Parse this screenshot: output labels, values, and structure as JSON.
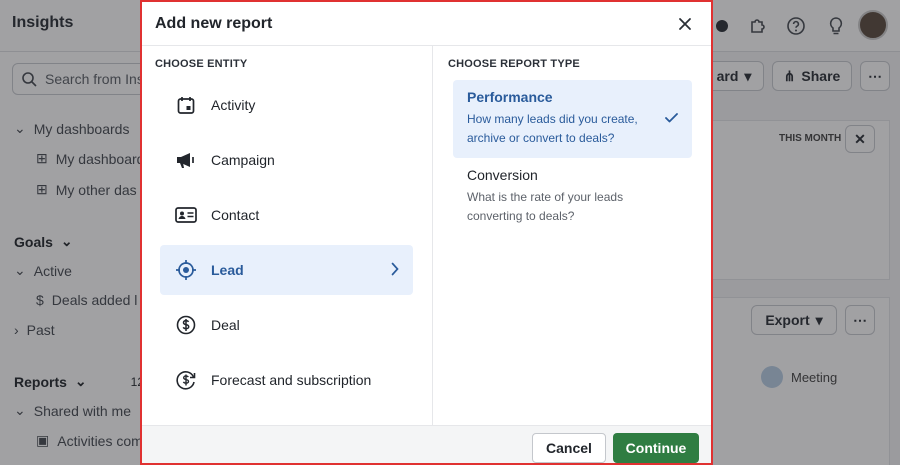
{
  "background": {
    "app_title": "Insights",
    "search_placeholder": "Search from Ins",
    "sidebar": {
      "my_dashboards": "My dashboards",
      "my_dashboard": "My dashboard",
      "my_other_dashboard": "My other das",
      "goals": "Goals",
      "active": "Active",
      "deals_added": "Deals added l",
      "past": "Past",
      "reports": "Reports",
      "reports_count": "12/",
      "shared_with_me": "Shared with me",
      "activities": "Activities com"
    },
    "right_panel": {
      "dashboard_btn": "ard",
      "share_btn": "Share",
      "this_month": "THIS MONTH",
      "export_btn": "Export",
      "meeting": "Meeting"
    }
  },
  "modal": {
    "title": "Add new report",
    "entity_heading": "CHOOSE ENTITY",
    "report_heading": "CHOOSE REPORT TYPE",
    "entities": [
      {
        "label": "Activity",
        "icon": "calendar-icon"
      },
      {
        "label": "Campaign",
        "icon": "megaphone-icon"
      },
      {
        "label": "Contact",
        "icon": "contact-card-icon"
      },
      {
        "label": "Lead",
        "icon": "target-icon",
        "selected": true
      },
      {
        "label": "Deal",
        "icon": "dollar-icon"
      },
      {
        "label": "Forecast and subscription",
        "icon": "recurring-dollar-icon"
      }
    ],
    "report_types": [
      {
        "title": "Performance",
        "description": "How many leads did you create, archive or convert to deals?",
        "selected": true
      },
      {
        "title": "Conversion",
        "description": "What is the rate of your leads converting to deals?"
      }
    ],
    "cancel_label": "Cancel",
    "continue_label": "Continue"
  },
  "colors": {
    "accent_blue": "#2a5b9b",
    "selected_bg": "#e8f0fc",
    "continue_green": "#2f7d42",
    "highlight_border": "#e03131"
  }
}
